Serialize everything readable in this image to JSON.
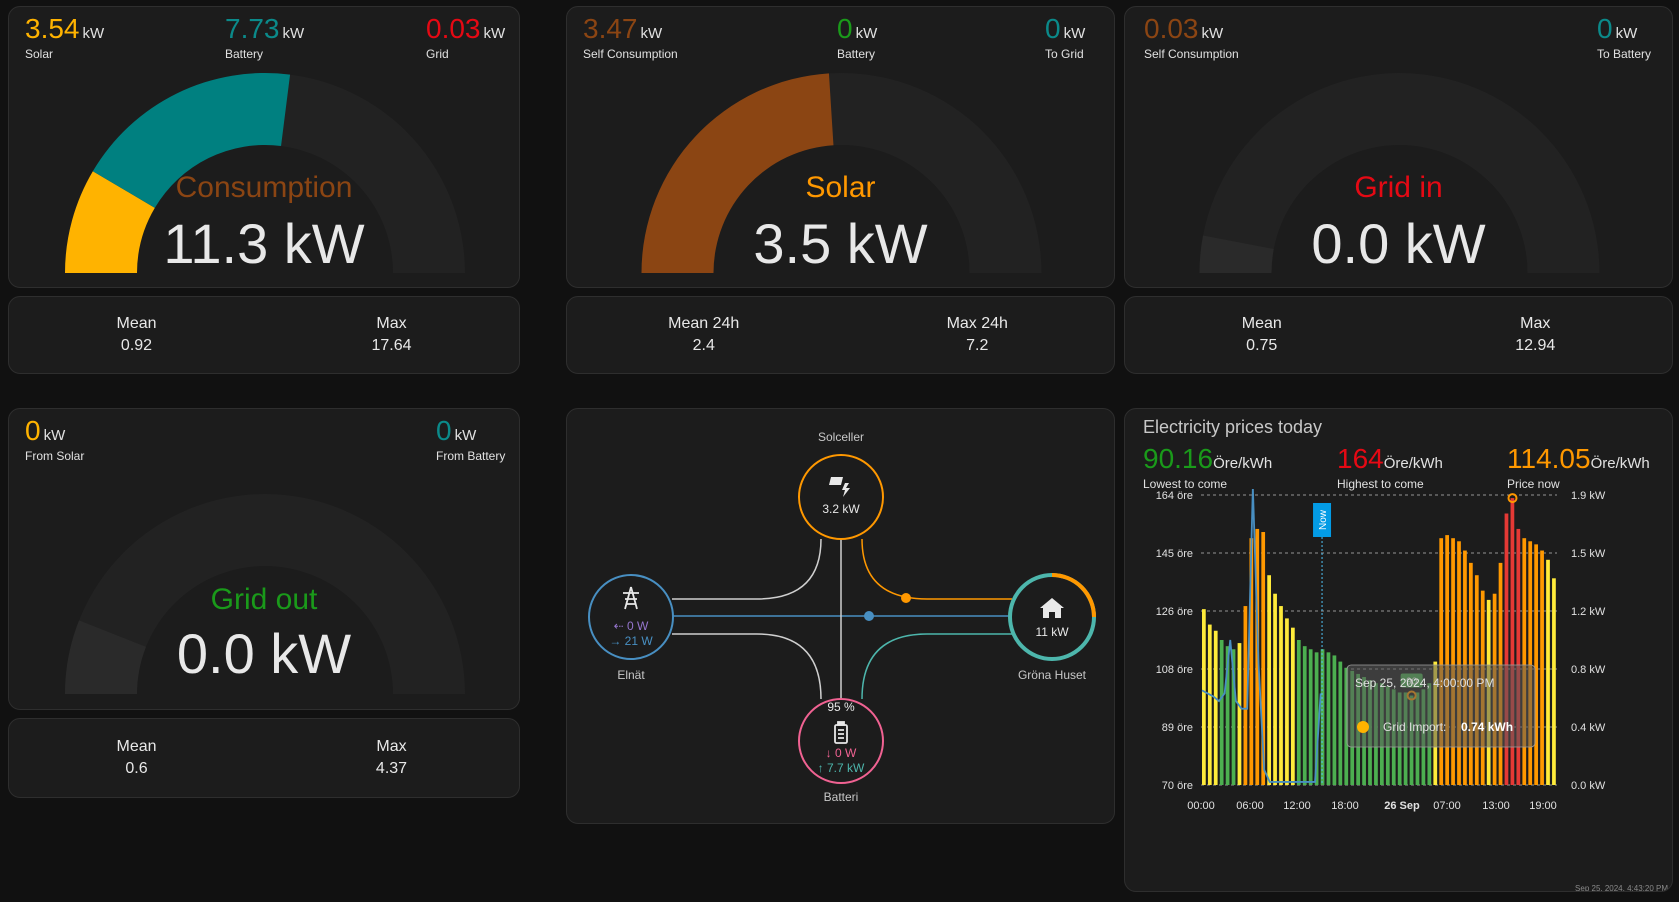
{
  "consumption": {
    "stats": [
      {
        "value": "3.54",
        "unit": "kW",
        "label": "Solar",
        "color": "#ffb300"
      },
      {
        "value": "7.73",
        "unit": "kW",
        "label": "Battery",
        "color": "#0b8a8a"
      },
      {
        "value": "0.03",
        "unit": "kW",
        "label": "Grid",
        "color": "#e50914"
      }
    ],
    "gauge_title": "Consumption",
    "gauge_value": "11.3 kW",
    "segments": [
      {
        "name": "solar",
        "fraction": 0.17,
        "color": "#ffb300"
      },
      {
        "name": "battery",
        "fraction": 0.37,
        "color": "#008080"
      }
    ],
    "mean_label": "Mean",
    "mean_value": "0.92",
    "max_label": "Max",
    "max_value": "17.64"
  },
  "solar": {
    "stats": [
      {
        "value": "3.47",
        "unit": "kW",
        "label": "Self Consumption",
        "color": "#8b4513"
      },
      {
        "value": "0",
        "unit": "kW",
        "label": "Battery",
        "color": "#1a9a1a"
      },
      {
        "value": "0",
        "unit": "kW",
        "label": "To Grid",
        "color": "#0b8a8a"
      }
    ],
    "gauge_title": "Solar",
    "gauge_value": "3.5 kW",
    "segments": [
      {
        "name": "self",
        "fraction": 0.48,
        "color": "#8b4513"
      }
    ],
    "mean_label": "Mean 24h",
    "mean_value": "2.4",
    "max_label": "Max 24h",
    "max_value": "7.2"
  },
  "grid_in": {
    "stats": [
      {
        "value": "0.03",
        "unit": "kW",
        "label": "Self Consumption",
        "color": "#8b4513"
      },
      {
        "value": "0",
        "unit": "kW",
        "label": "To Battery",
        "color": "#0b8a8a"
      }
    ],
    "gauge_title": "Grid in",
    "gauge_value": "0.0 kW",
    "segments": [
      {
        "name": "in",
        "fraction": 0.06,
        "color": "#2a2a2a"
      }
    ],
    "mean_label": "Mean",
    "mean_value": "0.75",
    "max_label": "Max",
    "max_value": "12.94"
  },
  "grid_out": {
    "stats": [
      {
        "value": "0",
        "unit": "kW",
        "label": "From Solar",
        "color": "#ffb300"
      },
      {
        "value": "0",
        "unit": "kW",
        "label": "From Battery",
        "color": "#0b8a8a"
      }
    ],
    "gauge_title": "Grid out",
    "gauge_value": "0.0 kW",
    "segments": [
      {
        "name": "out",
        "fraction": 0.12,
        "color": "#2a2a2a"
      }
    ],
    "mean_label": "Mean",
    "mean_value": "0.6",
    "max_label": "Max",
    "max_value": "4.37"
  },
  "flow": {
    "solar_label": "Solceller",
    "solar_value": "3.2 kW",
    "grid_label": "Elnät",
    "grid_in": "0 W",
    "grid_out": "21 W",
    "home_label": "Gröna Huset",
    "home_value": "11 kW",
    "battery_label": "Batteri",
    "battery_pct": "95 %",
    "battery_in": "0 W",
    "battery_out": "7.7 kW",
    "colors": {
      "solar": "#ff9800",
      "grid": "#488fc2",
      "home": "#4db6ac",
      "battery": "#f06292"
    }
  },
  "prices": {
    "title": "Electricity prices today",
    "lowest": {
      "value": "90.16",
      "unit": "Öre/kWh",
      "label": "Lowest to come",
      "color": "#1a9a1a"
    },
    "highest": {
      "value": "164",
      "unit": "Öre/kWh",
      "label": "Highest to come",
      "color": "#e50914"
    },
    "now": {
      "value": "114.05",
      "unit": "Öre/kWh",
      "label": "Price now",
      "color": "#ff9800"
    },
    "now_marker": "Now",
    "max_marker": "164",
    "min_marker": "90",
    "tooltip_time": "Sep 25, 2024, 4:00:00 PM",
    "tooltip_series": "Grid Import:",
    "tooltip_value": "0.74 kWh",
    "footer": "Sep 25, 2024, 4:43:20 PM"
  },
  "chart_data": {
    "type": "bar",
    "title": "Electricity prices today",
    "y_left_ticks": [
      "164 öre",
      "145 öre",
      "126 öre",
      "108 öre",
      "89 öre",
      "70 öre"
    ],
    "y_right_ticks": [
      "1.9 kW",
      "1.5 kW",
      "1.2 kW",
      "0.8 kW",
      "0.4 kW",
      "0.0 kW"
    ],
    "x_ticks": [
      "00:00",
      "06:00",
      "12:00",
      "18:00",
      "26 Sep",
      "07:00",
      "13:00",
      "19:00"
    ],
    "ylim": [
      70,
      164
    ],
    "price_series": {
      "name": "Price",
      "values": [
        127,
        122,
        120,
        117,
        115,
        114,
        116,
        128,
        150,
        153,
        152,
        138,
        132,
        128,
        124,
        121,
        117,
        115,
        114,
        113,
        114,
        113,
        112,
        110,
        108,
        107,
        106,
        105,
        104,
        103,
        103,
        102,
        101,
        100,
        100,
        99,
        100,
        101,
        103,
        110,
        150,
        151,
        150,
        149,
        146,
        142,
        138,
        133,
        130,
        132,
        142,
        158,
        163,
        153,
        150,
        149,
        148,
        146,
        143,
        137
      ],
      "colors": [
        "#ffeb3b",
        "#ffeb3b",
        "#ffeb3b",
        "#4caf50",
        "#4caf50",
        "#4caf50",
        "#ffeb3b",
        "#ff9800",
        "#ff9800",
        "#ff9800",
        "#ff9800",
        "#ffeb3b",
        "#ffeb3b",
        "#ffeb3b",
        "#ffeb3b",
        "#ffeb3b",
        "#4caf50",
        "#4caf50",
        "#4caf50",
        "#4caf50",
        "#4caf50",
        "#4caf50",
        "#4caf50",
        "#4caf50",
        "#4caf50",
        "#4caf50",
        "#4caf50",
        "#4caf50",
        "#4caf50",
        "#4caf50",
        "#4caf50",
        "#4caf50",
        "#4caf50",
        "#4caf50",
        "#4caf50",
        "#4caf50",
        "#4caf50",
        "#4caf50",
        "#4caf50",
        "#ffeb3b",
        "#ff9800",
        "#ff9800",
        "#ff9800",
        "#ff9800",
        "#ff9800",
        "#ff9800",
        "#ff9800",
        "#ff9800",
        "#ffeb3b",
        "#ff9800",
        "#ff9800",
        "#e53935",
        "#e53935",
        "#e53935",
        "#ff9800",
        "#ff9800",
        "#ff9800",
        "#ff9800",
        "#ffeb3b",
        "#ffeb3b"
      ]
    },
    "grid_import_series": {
      "name": "Grid Import",
      "color": "#488fc2",
      "values_kw": [
        0.62,
        0.6,
        0.58,
        0.55,
        0.6,
        0.95,
        0.55,
        0.5,
        0.5,
        1.95,
        0.8,
        0.1,
        0.02,
        0.02,
        0.02,
        0.02,
        0.02,
        0.02,
        0.02,
        0.02,
        0.02,
        0.6
      ]
    },
    "now_index": 20,
    "tooltip_index": 21
  }
}
